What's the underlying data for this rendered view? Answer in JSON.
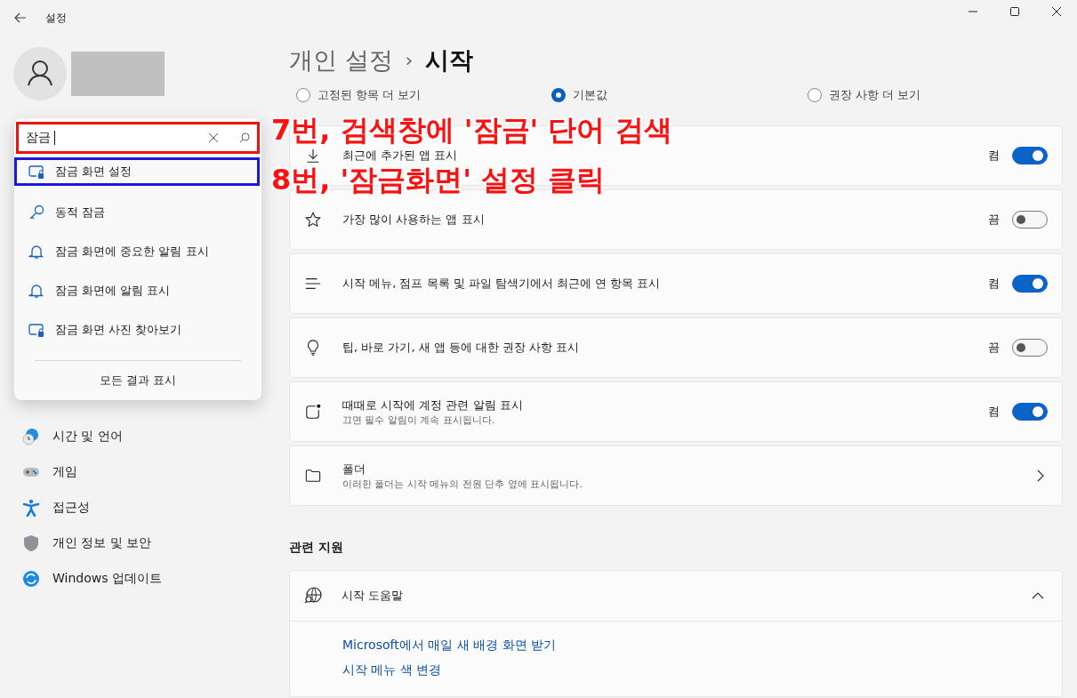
{
  "window": {
    "title": "설정"
  },
  "search": {
    "value": "잠금",
    "highlighted": true
  },
  "search_results": [
    {
      "label": "잠금 화면 설정",
      "kind": "lock-screen",
      "highlighted": true
    },
    {
      "label": "동적 잠금",
      "kind": "key",
      "highlighted": false
    },
    {
      "label": "잠금 화면에 중요한 알림 표시",
      "kind": "bell",
      "highlighted": false
    },
    {
      "label": "잠금 화면에 알림 표시",
      "kind": "bell",
      "highlighted": false
    },
    {
      "label": "잠금 화면 사진 찾아보기",
      "kind": "lock-screen",
      "highlighted": false
    }
  ],
  "show_all": "모든 결과 표시",
  "nav_items": [
    {
      "label": "시간 및 언어",
      "kind": "time"
    },
    {
      "label": "게임",
      "kind": "gaming"
    },
    {
      "label": "접근성",
      "kind": "accessibility"
    },
    {
      "label": "개인 정보 및 보안",
      "kind": "privacy"
    },
    {
      "label": "Windows 업데이트",
      "kind": "update"
    }
  ],
  "breadcrumb": {
    "parent": "개인 설정",
    "separator": "›",
    "current": "시작"
  },
  "layout_options": [
    {
      "label": "고정된 항목 더 보기",
      "selected": false
    },
    {
      "label": "기본값",
      "selected": true
    },
    {
      "label": "권장 사항 더 보기",
      "selected": false
    }
  ],
  "settings": [
    {
      "kind": "toggle",
      "label": "최근에 추가된 앱 표시",
      "on": true,
      "state_label": "켬"
    },
    {
      "kind": "toggle",
      "label": "가장 많이 사용하는 앱 표시",
      "on": false,
      "state_label": "끔"
    },
    {
      "kind": "toggle",
      "label": "시작 메뉴, 점프 목록 및 파일 탐색기에서 최근에 연 항목 표시",
      "on": true,
      "state_label": "켬"
    },
    {
      "kind": "toggle",
      "label": "팁, 바로 가기, 새 앱 등에 대한 권장 사항 표시",
      "on": false,
      "state_label": "끔"
    },
    {
      "kind": "toggle",
      "label": "때때로 시작에 계정 관련 알림 표시",
      "description": "끄면 필수 알림이 계속 표시됩니다.",
      "on": true,
      "state_label": "켬"
    },
    {
      "kind": "link",
      "label": "폴더",
      "description": "이러한 폴더는 시작 메뉴의 전원 단추 옆에 표시됩니다."
    }
  ],
  "related_support": {
    "heading": "관련 지원",
    "title": "시작 도움말",
    "expanded": true,
    "links": [
      "Microsoft에서 매일 새 배경 화면 받기",
      "시작 메뉴 색 변경"
    ]
  },
  "annotations": [
    "7번, 검색창에 '잠금' 단어 검색",
    "8번, '잠금화면' 설정 클릭"
  ]
}
